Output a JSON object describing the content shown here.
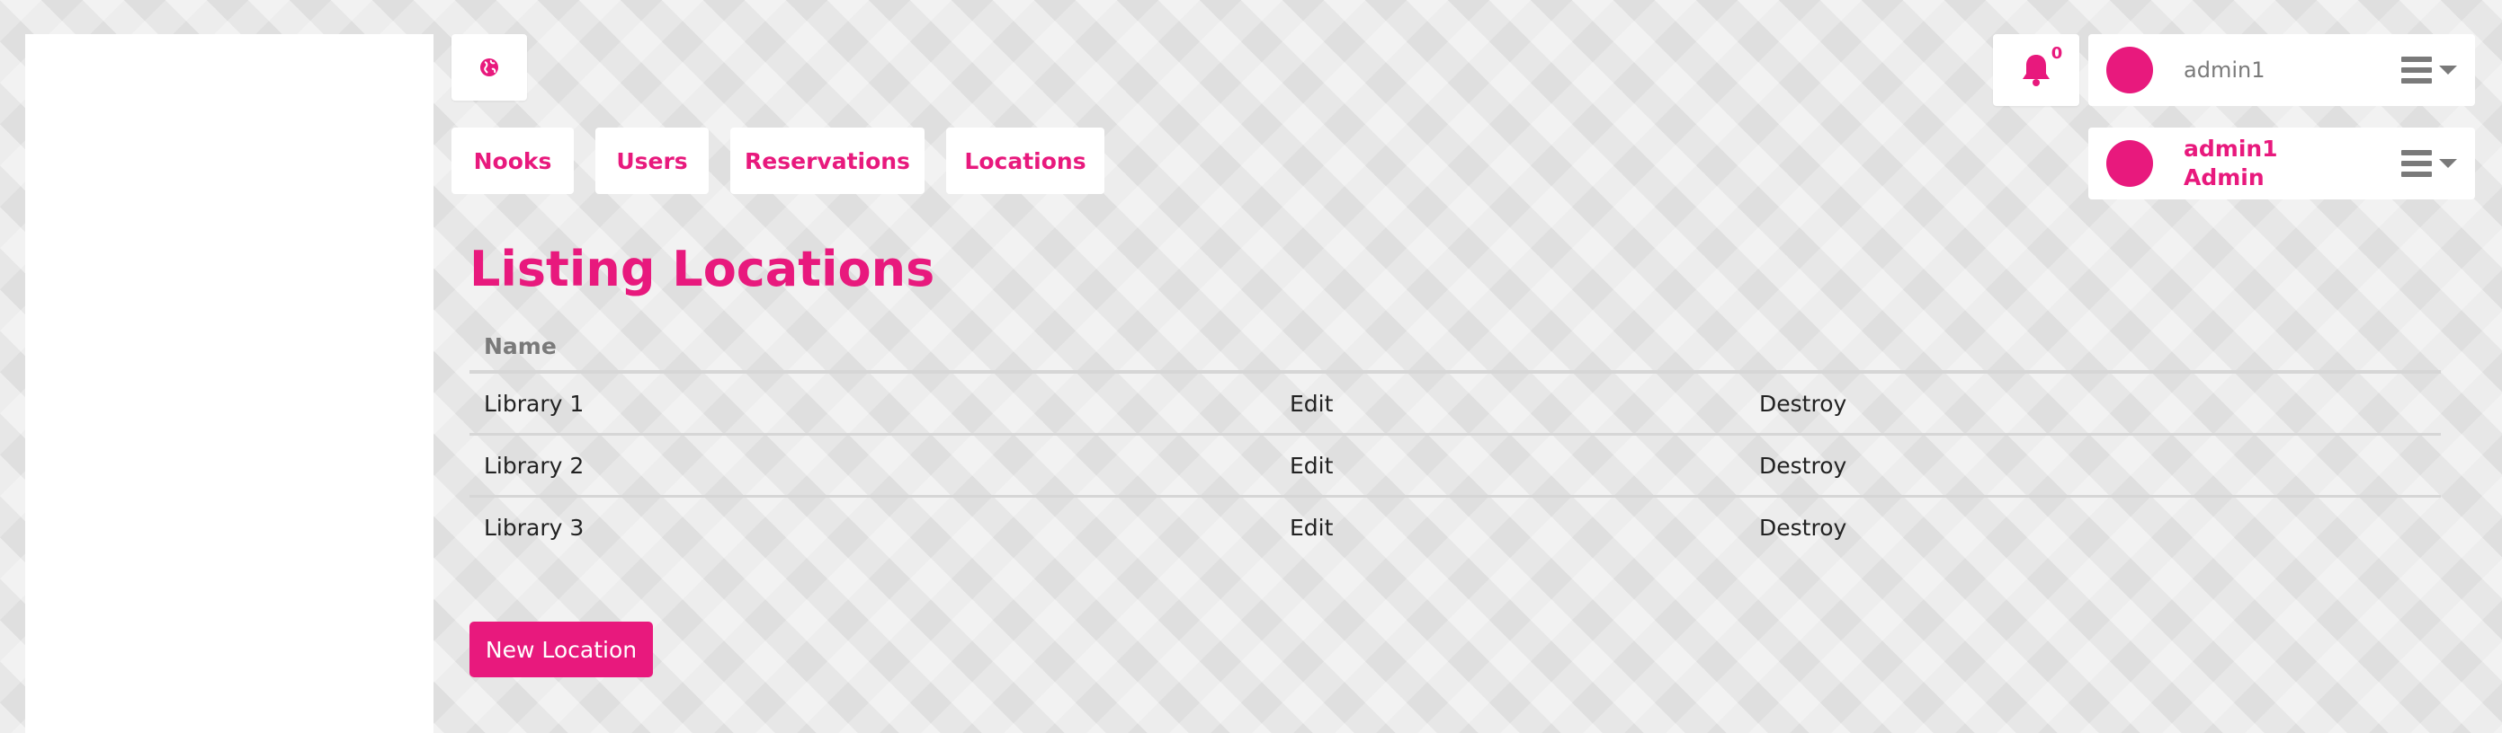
{
  "nav": {
    "items": [
      {
        "label": "Nooks"
      },
      {
        "label": "Users"
      },
      {
        "label": "Reservations"
      },
      {
        "label": "Locations"
      }
    ]
  },
  "notifications": {
    "count": "0"
  },
  "user_menu": {
    "username": "admin1",
    "profile_name": "admin1",
    "role": "Admin"
  },
  "main": {
    "title": "Listing Locations",
    "table": {
      "headers": [
        "Name",
        "",
        ""
      ],
      "rows": [
        {
          "name": "Library 1",
          "edit": "Edit",
          "destroy": "Destroy"
        },
        {
          "name": "Library 2",
          "edit": "Edit",
          "destroy": "Destroy"
        },
        {
          "name": "Library 3",
          "edit": "Edit",
          "destroy": "Destroy"
        }
      ]
    },
    "new_button": "New Location"
  },
  "colors": {
    "accent": "#e8197d",
    "muted": "#7a7a7a",
    "background": "#e7e7e7"
  },
  "icons": [
    "globe-icon",
    "bell-icon",
    "hamburger-icon",
    "caret-down-icon"
  ]
}
